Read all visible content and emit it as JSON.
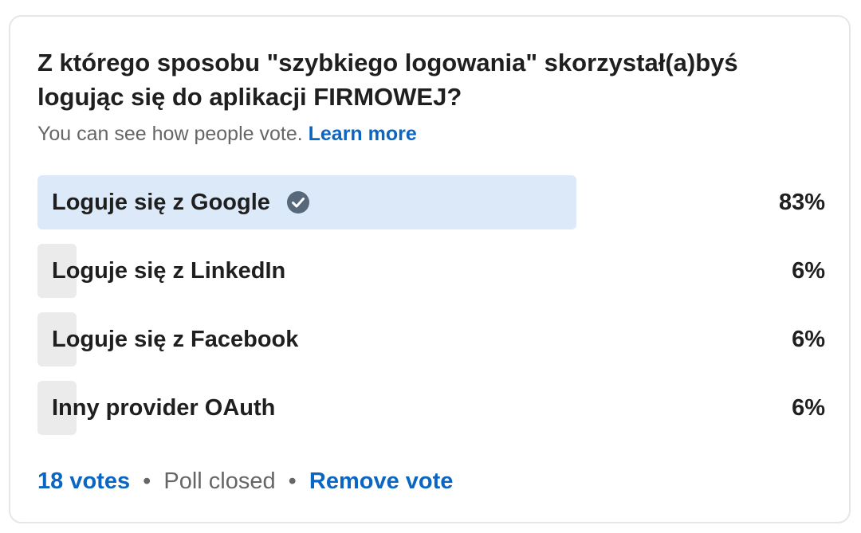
{
  "poll": {
    "question": "Z którego sposobu \"szybkiego logowania\" skorzystał(a)byś logując się do aplikacji FIRMOWEJ?",
    "visibility_note": "You can see how people vote.",
    "learn_more_label": "Learn more",
    "options": [
      {
        "label": "Loguje się z Google",
        "percent_text": "83%",
        "percent": 83,
        "selected": true,
        "icon": "check-circle-icon"
      },
      {
        "label": "Loguje się z LinkedIn",
        "percent_text": "6%",
        "percent": 6,
        "selected": false
      },
      {
        "label": "Loguje się z Facebook",
        "percent_text": "6%",
        "percent": 6,
        "selected": false
      },
      {
        "label": "Inny provider OAuth",
        "percent_text": "6%",
        "percent": 6,
        "selected": false
      }
    ],
    "votes_label": "18 votes",
    "status": "Poll closed",
    "separator": "•",
    "remove_vote_label": "Remove vote"
  },
  "colors": {
    "accent": "#0a66c2",
    "selected_fill": "#dce9f9",
    "unselected_fill": "#ebebeb",
    "check_icon": "#56687a"
  }
}
